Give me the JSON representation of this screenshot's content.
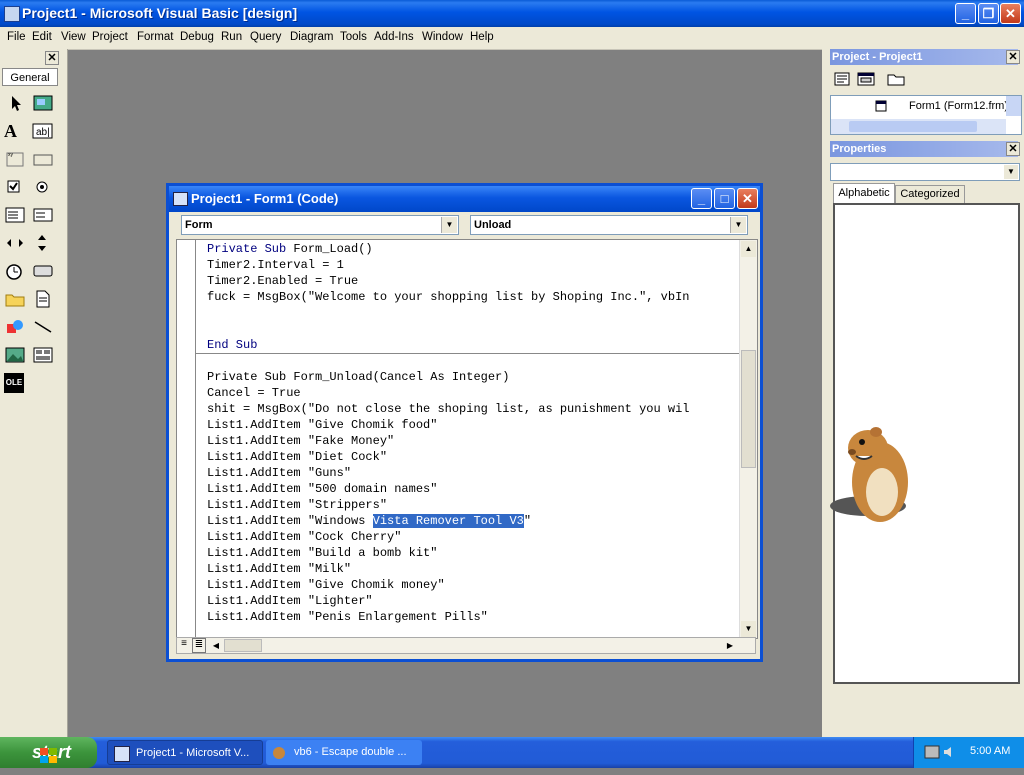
{
  "titlebar": {
    "title": "Project1 - Microsoft Visual Basic [design]"
  },
  "menu": [
    "File",
    "Edit",
    "View",
    "Project",
    "Format",
    "Debug",
    "Run",
    "Query",
    "Diagram",
    "Tools",
    "Add-Ins",
    "Window",
    "Help"
  ],
  "toolbox": {
    "tab_label": "General",
    "tools": [
      "pointer-icon",
      "picturebox-icon",
      "label-icon",
      "textbox-icon",
      "frame-icon",
      "commandbutton-icon",
      "checkbox-icon",
      "optionbutton-icon",
      "combobox-icon",
      "listbox-icon",
      "hscrollbar-icon",
      "vscrollbar-icon",
      "timer-icon",
      "drivelistbox-icon",
      "dirlistbox-icon",
      "filelistbox-icon",
      "shape-icon",
      "line-icon",
      "image-icon",
      "data-icon",
      "ole-icon"
    ],
    "ole_label": "OLE"
  },
  "project": {
    "title": "Project - Project1",
    "tree_item": "Form1 (Form12.frm)"
  },
  "properties": {
    "title": "Properties",
    "tabs": [
      "Alphabetic",
      "Categorized"
    ]
  },
  "codewindow": {
    "title": "Project1 - Form1 (Code)",
    "object_combo": "Form",
    "proc_combo": "Unload",
    "lines": [
      "Private Sub Form_Load()",
      "Timer2.Interval = 1",
      "Timer2.Enabled = True",
      "fuck = MsgBox(\"Welcome to your shopping list by Shoping Inc.\", vbIn",
      "",
      "",
      "End Sub",
      "",
      "Private Sub Form_Unload(Cancel As Integer)",
      "Cancel = True",
      "shit = MsgBox(\"Do not close the shoping list, as punishment you wil",
      "List1.AddItem \"Give Chomik food\"",
      "List1.AddItem \"Fake Money\"",
      "List1.AddItem \"Diet Cock\"",
      "List1.AddItem \"Guns\"",
      "List1.AddItem \"500 domain names\"",
      "List1.AddItem \"Strippers\"",
      "List1.AddItem \"Windows ",
      "List1.AddItem \"Cock Cherry\"",
      "List1.AddItem \"Build a bomb kit\"",
      "List1.AddItem \"Milk\"",
      "List1.AddItem \"Give Chomik money\"",
      "List1.AddItem \"Lighter\"",
      "List1.AddItem \"Penis Enlargement Pills\""
    ],
    "selected_text": "Vista Remover Tool V3",
    "after_selection": "\""
  },
  "taskbar": {
    "start_label": "start",
    "tasks": [
      "Project1 - Microsoft V...",
      "vb6 - Escape double ..."
    ],
    "clock": "5:00 AM"
  },
  "colors": {
    "code_keyword": "#00007f",
    "selection": "#3169c6",
    "desktop": "#808080"
  }
}
